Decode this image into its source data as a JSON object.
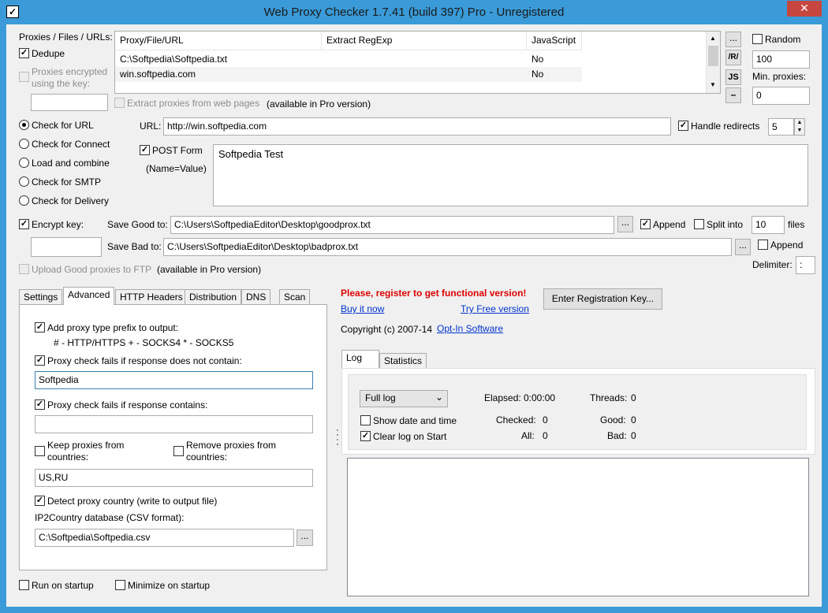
{
  "window": {
    "title": "Web Proxy Checker 1.7.41 (build 397) Pro - Unregistered",
    "close": "✕"
  },
  "proxies": {
    "label": "Proxies / Files / URLs:",
    "dedupe": "Dedupe",
    "encrypted": "Proxies encrypted",
    "encrypted2": "using the key:",
    "columns": [
      "Proxy/File/URL",
      "Extract RegExp",
      "JavaScript"
    ],
    "rows": [
      [
        "C:\\Softpedia\\Softpedia.txt",
        "",
        "No"
      ],
      [
        "win.softpedia.com",
        "",
        "No"
      ]
    ],
    "extract_web": "Extract proxies from web pages",
    "extract_note": "(available in Pro version)"
  },
  "side": {
    "btn_dots": "...",
    "btn_r": "/R/",
    "btn_js": "JS",
    "btn_minus": "–",
    "random": "Random",
    "random_value": "100",
    "min_proxies": "Min. proxies:",
    "min_value": "0"
  },
  "check": {
    "options": [
      "Check for URL",
      "Check for Connect",
      "Load and combine",
      "Check for SMTP",
      "Check for Delivery"
    ],
    "url_label": "URL:",
    "url_value": "http://win.softpedia.com",
    "handle_redirects": "Handle redirects",
    "redirects_value": "5",
    "post_form": "POST Form",
    "name_value": "(Name=Value)",
    "post_text": "Softpedia Test"
  },
  "save": {
    "encrypt_key": "Encrypt key:",
    "good_label": "Save Good to:",
    "good_path": "C:\\Users\\SoftpediaEditor\\Desktop\\goodprox.txt",
    "bad_label": "Save Bad to:",
    "bad_path": "C:\\Users\\SoftpediaEditor\\Desktop\\badprox.txt",
    "append": "Append",
    "split_into": "Split into",
    "split_value": "10",
    "files": "files",
    "append2": "Append",
    "delimiter": "Delimiter:",
    "delimiter_value": ":",
    "upload_ftp": "Upload Good proxies to FTP",
    "ftp_note": "(available in Pro version)",
    "btn_dots": "..."
  },
  "tabs": [
    "Settings",
    "Advanced",
    "HTTP Headers",
    "Distribution",
    "DNS",
    "Scan"
  ],
  "advanced": {
    "prefix": "Add proxy type prefix to output:",
    "prefix_hint": "# - HTTP/HTTPS  + - SOCKS4  * - SOCKS5",
    "not_contain": "Proxy check fails if response does not contain:",
    "not_contain_value": "Softpedia",
    "contains": "Proxy check fails if response contains:",
    "contains_value": "",
    "keep": "Keep proxies from",
    "keep2": "countries:",
    "remove": "Remove proxies from",
    "remove2": "countries:",
    "countries_value": "US,RU",
    "detect": "Detect proxy country (write to output file)",
    "ip2country": "IP2Country database (CSV format):",
    "csv_value": "C:\\Softpedia\\Softpedia.csv",
    "btn_dots": "..."
  },
  "register": {
    "warning": "Please, register to get functional version!",
    "buy": "Buy it now",
    "try": "Try Free version",
    "enter_key": "Enter Registration Key...",
    "copyright": "Copyright (c) 2007-14",
    "company": "Opt-In Software"
  },
  "log": {
    "tabs": [
      "Log",
      "Statistics"
    ],
    "mode": "Full log",
    "arrow": "⌄",
    "show_date": "Show date and time",
    "clear_log": "Clear log on Start",
    "elapsed_label": "Elapsed:",
    "elapsed_value": "0:00:00",
    "threads_label": "Threads:",
    "threads_value": "0",
    "checked_label": "Checked:",
    "checked_value": "0",
    "good_label": "Good:",
    "good_value": "0",
    "all_label": "All:",
    "all_value": "0",
    "bad_label": "Bad:",
    "bad_value": "0"
  },
  "bottom": {
    "run_startup": "Run on startup",
    "minimize_startup": "Minimize on startup"
  }
}
